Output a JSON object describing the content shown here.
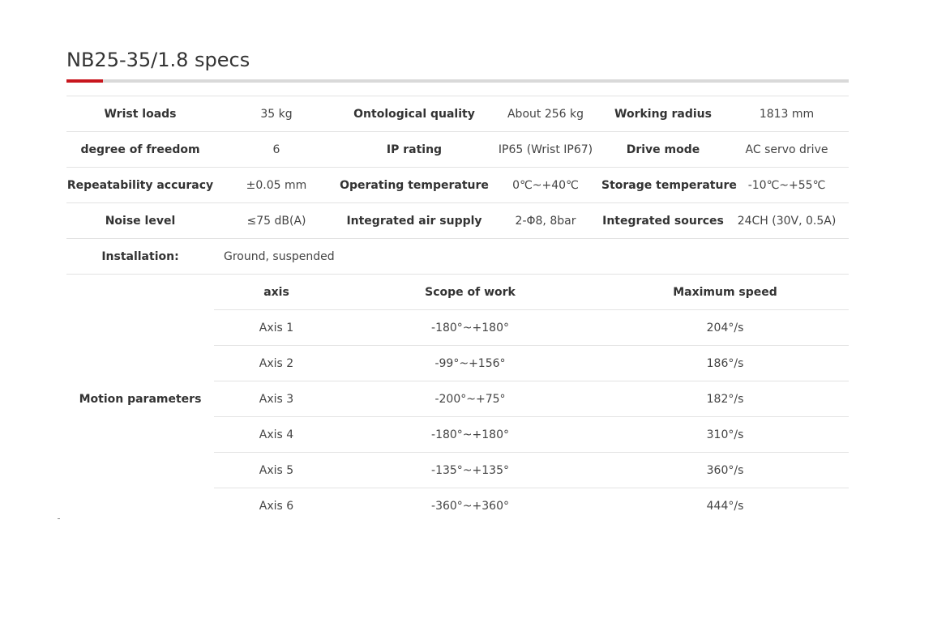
{
  "title": "NB25-35/1.8 specs",
  "colors": {
    "accent": "#c8161d",
    "rule": "#d9d9d9",
    "row_border": "#e3e3e3"
  },
  "specs": {
    "wrist_loads": {
      "label": "Wrist loads",
      "value": "35 kg"
    },
    "ontological_quality": {
      "label": "Ontological quality",
      "value": "About 256 kg"
    },
    "working_radius": {
      "label": "Working radius",
      "value": "1813 mm"
    },
    "degree_of_freedom": {
      "label": "degree of freedom",
      "value": "6"
    },
    "ip_rating": {
      "label": "IP rating",
      "value": "IP65 (Wrist IP67)"
    },
    "drive_mode": {
      "label": "Drive mode",
      "value": "AC servo drive"
    },
    "repeatability_accuracy": {
      "label": "Repeatability accuracy",
      "value": "±0.05 mm"
    },
    "operating_temperature": {
      "label": "Operating temperature",
      "value": "0℃~+40℃"
    },
    "storage_temperature": {
      "label": "Storage temperature",
      "value": "-10℃~+55℃"
    },
    "noise_level": {
      "label": "Noise level",
      "value": "≤75 dB(A)"
    },
    "integrated_air_supply": {
      "label": "Integrated air supply",
      "value": "2-Φ8, 8bar"
    },
    "integrated_sources": {
      "label": "Integrated sources",
      "value": "24CH (30V, 0.5A)"
    },
    "installation": {
      "label": "Installation:",
      "value": "Ground, suspended"
    }
  },
  "motion": {
    "label": "Motion parameters",
    "headers": {
      "axis": "axis",
      "scope": "Scope of work",
      "speed": "Maximum speed"
    },
    "rows": [
      {
        "axis": "Axis 1",
        "scope": "-180°~+180°",
        "speed": "204°/s"
      },
      {
        "axis": "Axis 2",
        "scope": "-99°~+156°",
        "speed": "186°/s"
      },
      {
        "axis": "Axis 3",
        "scope": "-200°~+75°",
        "speed": "182°/s"
      },
      {
        "axis": "Axis 4",
        "scope": "-180°~+180°",
        "speed": "310°/s"
      },
      {
        "axis": "Axis 5",
        "scope": "-135°~+135°",
        "speed": "360°/s"
      },
      {
        "axis": "Axis 6",
        "scope": "-360°~+360°",
        "speed": "444°/s"
      }
    ]
  }
}
